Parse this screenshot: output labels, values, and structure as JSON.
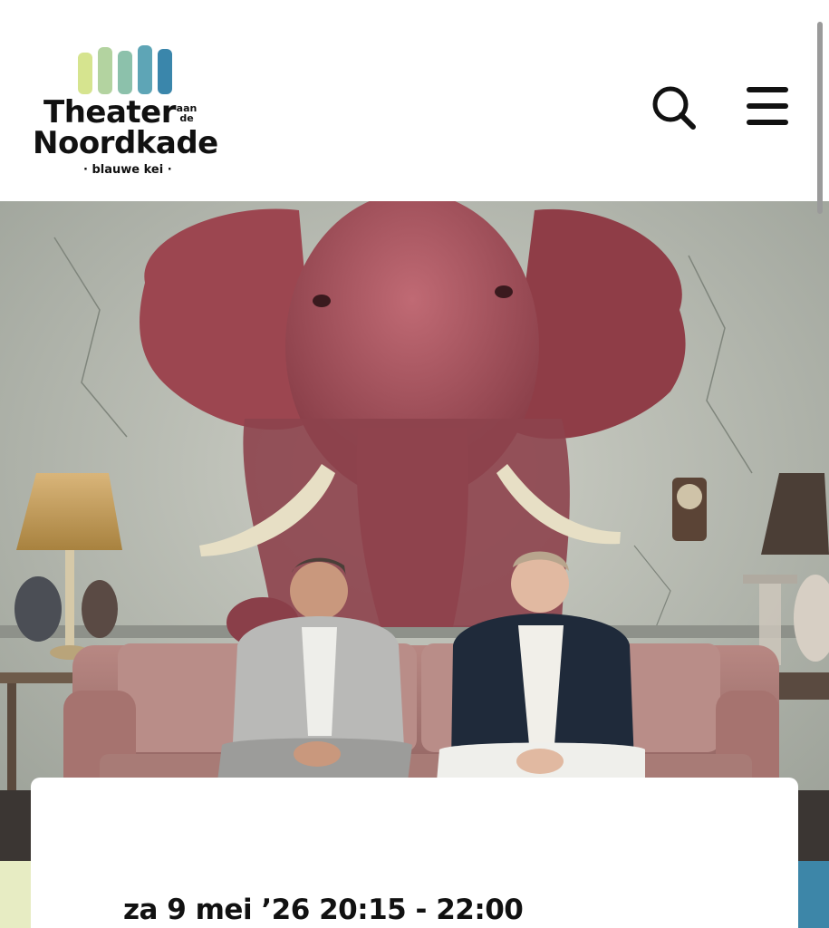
{
  "brand": {
    "name_line1": "Theater",
    "name_small_1": "aan",
    "name_small_2": "de",
    "name_line2": "Noordkade",
    "tagline": "· blauwe kei ·",
    "bar_colors": [
      "#d6e48f",
      "#b3d3a0",
      "#8cc1ab",
      "#5ea5b6",
      "#3a86ab"
    ]
  },
  "header": {
    "search_icon": "search-icon",
    "menu_icon": "hamburger-menu-icon"
  },
  "hero": {
    "image_subject": "pink-elephant-living-room-photo"
  },
  "event": {
    "datetime": "za 9 mei ’26 20:15 - 22:00"
  },
  "colors": {
    "accent_left": "#e7ecc3",
    "accent_right": "#3d86a8",
    "text": "#111111"
  }
}
